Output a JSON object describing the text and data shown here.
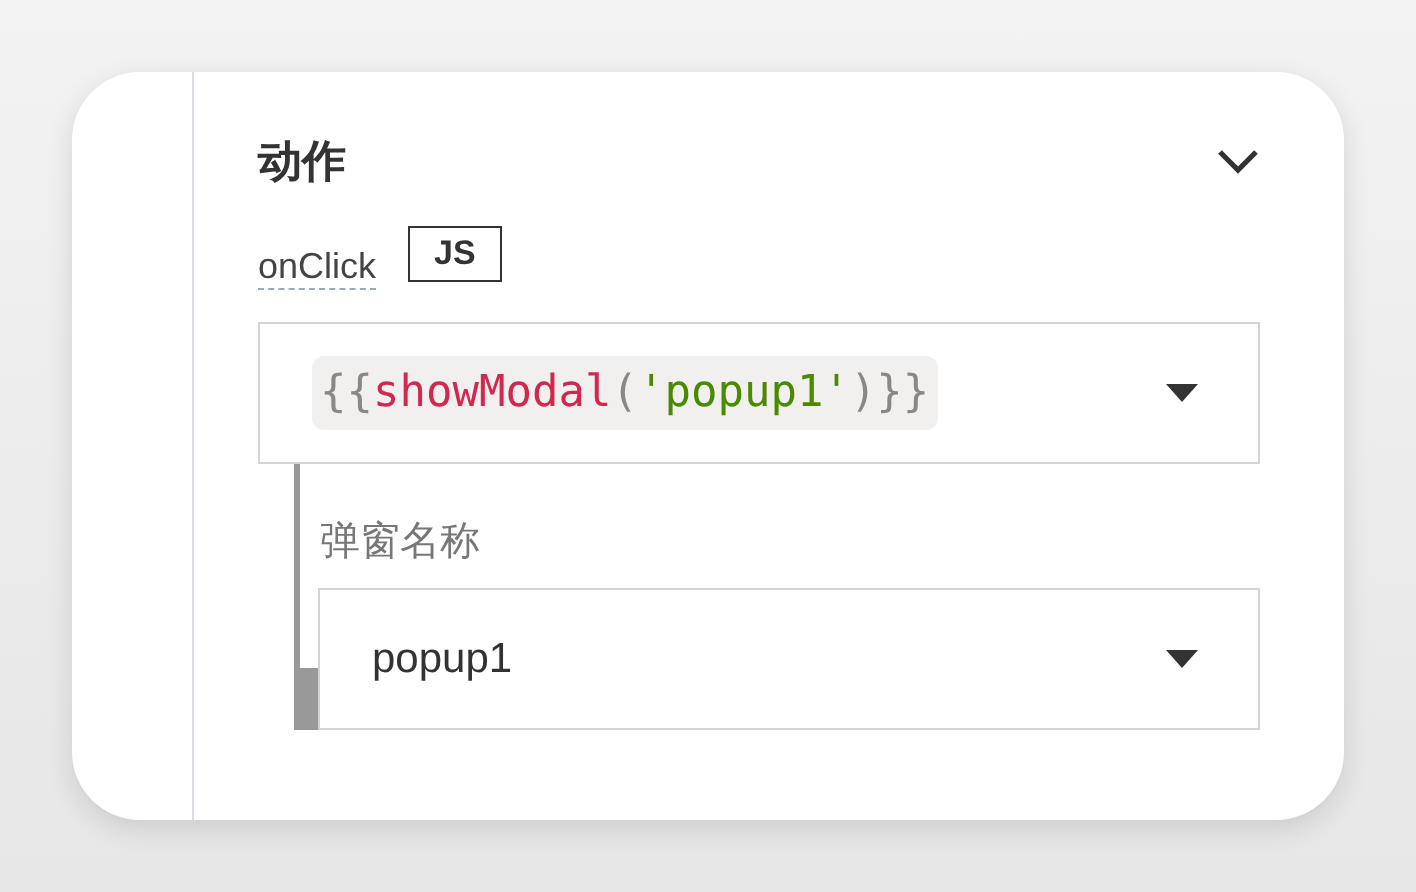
{
  "section": {
    "title": "动作",
    "expanded": true
  },
  "event": {
    "label": "onClick",
    "mode_badge": "JS"
  },
  "action_select": {
    "tokens": [
      {
        "kind": "punct",
        "text": "{{"
      },
      {
        "kind": "func",
        "text": "showModal"
      },
      {
        "kind": "punct",
        "text": "("
      },
      {
        "kind": "string",
        "text": "'popup1'"
      },
      {
        "kind": "punct",
        "text": ")}}"
      }
    ]
  },
  "params": [
    {
      "label": "弹窗名称",
      "value": "popup1"
    }
  ]
}
